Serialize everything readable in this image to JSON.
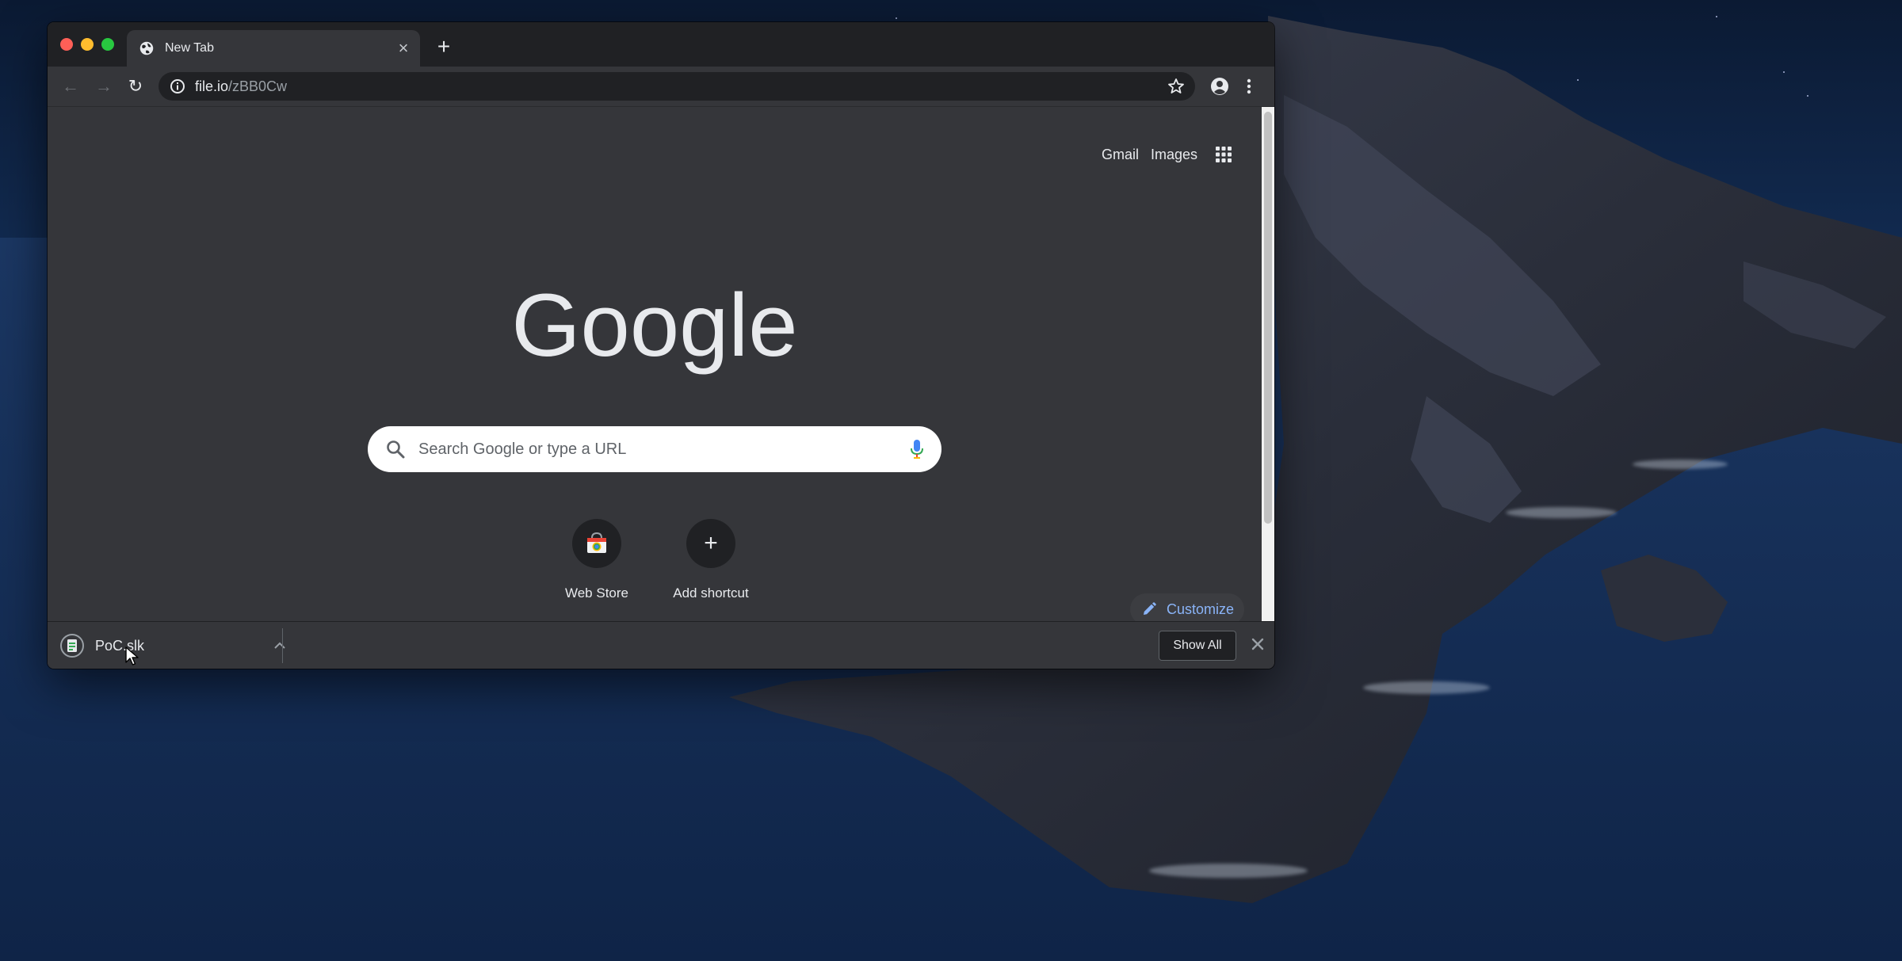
{
  "browser": {
    "tab": {
      "title": "New Tab",
      "close_glyph": "×"
    },
    "new_tab_glyph": "+",
    "toolbar": {
      "back_glyph": "←",
      "forward_glyph": "→",
      "reload_glyph": "↻",
      "url_host": "file.io",
      "url_path": "/zBB0Cw"
    }
  },
  "ntp": {
    "links": {
      "gmail": "Gmail",
      "images": "Images"
    },
    "logo": "Google",
    "search": {
      "placeholder": "Search Google or type a URL"
    },
    "shortcuts": [
      {
        "label": "Web Store"
      },
      {
        "label": "Add shortcut",
        "glyph": "+"
      }
    ],
    "customize_label": "Customize"
  },
  "download_shelf": {
    "filename": "PoC.slk",
    "show_all_label": "Show All"
  },
  "colors": {
    "google_logo": "#e8eaed",
    "accent_blue": "#8ab4f8",
    "tab_bg": "#35363a",
    "strip_bg": "#202124"
  },
  "icons": [
    "globe-icon",
    "info-icon",
    "star-icon",
    "profile-icon",
    "menu-icon",
    "apps-icon",
    "search-icon",
    "mic-icon",
    "webstore-icon",
    "plus-icon",
    "pencil-icon",
    "spreadsheet-file-icon",
    "chevron-up-icon",
    "close-icon"
  ]
}
